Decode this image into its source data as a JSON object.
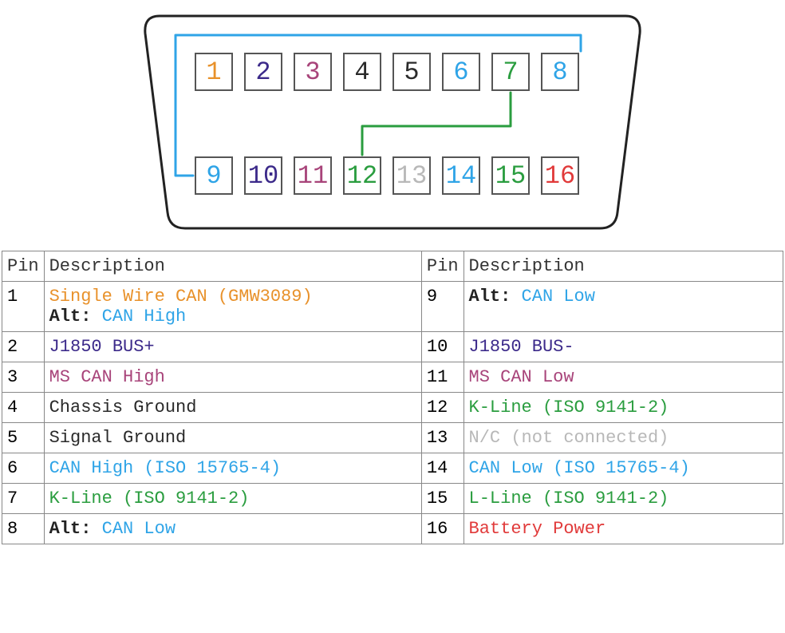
{
  "colors": {
    "orange": "#e8912a",
    "purple": "#3c2a8a",
    "magenta": "#a8447a",
    "black": "#2a2a2a",
    "blue": "#2fa4e7",
    "green": "#2a9d3f",
    "grey": "#b8b8b8",
    "red": "#e13a3a"
  },
  "pins": {
    "1": {
      "label": "1",
      "color": "orange"
    },
    "2": {
      "label": "2",
      "color": "purple"
    },
    "3": {
      "label": "3",
      "color": "magenta"
    },
    "4": {
      "label": "4",
      "color": "black"
    },
    "5": {
      "label": "5",
      "color": "black"
    },
    "6": {
      "label": "6",
      "color": "blue"
    },
    "7": {
      "label": "7",
      "color": "green"
    },
    "8": {
      "label": "8",
      "color": "blue"
    },
    "9": {
      "label": "9",
      "color": "blue"
    },
    "10": {
      "label": "10",
      "color": "purple"
    },
    "11": {
      "label": "11",
      "color": "magenta"
    },
    "12": {
      "label": "12",
      "color": "green"
    },
    "13": {
      "label": "13",
      "color": "grey"
    },
    "14": {
      "label": "14",
      "color": "blue"
    },
    "15": {
      "label": "15",
      "color": "green"
    },
    "16": {
      "label": "16",
      "color": "red"
    }
  },
  "table": {
    "headers": {
      "pin": "Pin",
      "desc": "Description"
    },
    "left": [
      {
        "pin": "1",
        "parts": [
          {
            "text": "Single Wire CAN (GMW3089)",
            "color": "orange"
          }
        ],
        "alt": {
          "label": "Alt:",
          "text": "CAN High",
          "color": "blue"
        }
      },
      {
        "pin": "2",
        "parts": [
          {
            "text": "J1850 BUS+",
            "color": "purple"
          }
        ]
      },
      {
        "pin": "3",
        "parts": [
          {
            "text": "MS CAN High",
            "color": "magenta"
          }
        ]
      },
      {
        "pin": "4",
        "parts": [
          {
            "text": "Chassis Ground",
            "color": "black"
          }
        ]
      },
      {
        "pin": "5",
        "parts": [
          {
            "text": "Signal Ground",
            "color": "black"
          }
        ]
      },
      {
        "pin": "6",
        "parts": [
          {
            "text": "CAN High (ISO 15765-4)",
            "color": "blue"
          }
        ]
      },
      {
        "pin": "7",
        "parts": [
          {
            "text": "K-Line (ISO 9141-2)",
            "color": "green"
          }
        ]
      },
      {
        "pin": "8",
        "alt": {
          "label": "Alt:",
          "text": "CAN Low",
          "color": "blue"
        }
      }
    ],
    "right": [
      {
        "pin": "9",
        "alt": {
          "label": "Alt:",
          "text": "CAN Low",
          "color": "blue"
        }
      },
      {
        "pin": "10",
        "parts": [
          {
            "text": "J1850 BUS-",
            "color": "purple"
          }
        ]
      },
      {
        "pin": "11",
        "parts": [
          {
            "text": "MS CAN Low",
            "color": "magenta"
          }
        ]
      },
      {
        "pin": "12",
        "parts": [
          {
            "text": "K-Line (ISO 9141-2)",
            "color": "green"
          }
        ]
      },
      {
        "pin": "13",
        "parts": [
          {
            "text": "N/C (not connected)",
            "color": "grey"
          }
        ]
      },
      {
        "pin": "14",
        "parts": [
          {
            "text": "CAN Low (ISO 15765-4)",
            "color": "blue"
          }
        ]
      },
      {
        "pin": "15",
        "parts": [
          {
            "text": "L-Line (ISO 9141-2)",
            "color": "green"
          }
        ]
      },
      {
        "pin": "16",
        "parts": [
          {
            "text": "Battery Power",
            "color": "red"
          }
        ]
      }
    ]
  },
  "links": [
    {
      "from": 8,
      "to": 9,
      "color": "blue"
    },
    {
      "from": 7,
      "to": 12,
      "color": "green"
    }
  ]
}
